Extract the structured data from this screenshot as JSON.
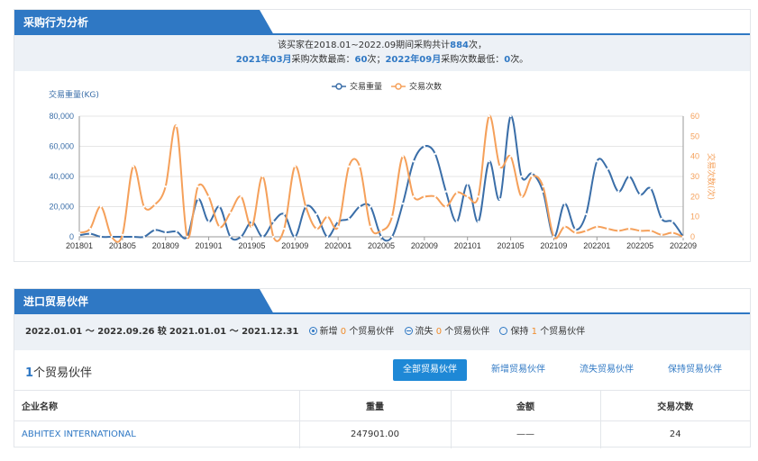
{
  "section1": {
    "title": "采购行为分析",
    "summary": {
      "line1_prefix": "该买家在2018.01~2022.09期间采购共计",
      "total": "884",
      "line1_suffix": "次，",
      "peak_month": "2021年03月",
      "peak_text": "采购次数最高：",
      "peak_value": "60",
      "peak_suffix": "次；",
      "low_month": "2022年09月",
      "low_text": "采购次数最低：",
      "low_value": "0",
      "low_suffix": "次。"
    }
  },
  "chart_data": {
    "type": "line",
    "title": "",
    "ylabel": "交易重量(KG)",
    "y2label": "交易次数(次)",
    "ylim": [
      0,
      80000
    ],
    "y2lim": [
      0,
      60
    ],
    "yticks": [
      "0",
      "20,000",
      "40,000",
      "60,000",
      "80,000"
    ],
    "y2ticks": [
      "0",
      "10",
      "20",
      "30",
      "40",
      "50",
      "60"
    ],
    "xticks": [
      "201801",
      "201805",
      "201809",
      "201901",
      "201905",
      "201909",
      "202001",
      "202005",
      "202009",
      "202101",
      "202105",
      "202109",
      "202201",
      "202205",
      "202209"
    ],
    "legend_position": "top-center",
    "x": [
      "201801",
      "201802",
      "201803",
      "201804",
      "201805",
      "201806",
      "201807",
      "201808",
      "201809",
      "201810",
      "201811",
      "201812",
      "201901",
      "201902",
      "201903",
      "201904",
      "201905",
      "201906",
      "201907",
      "201908",
      "201909",
      "201910",
      "201911",
      "201912",
      "202001",
      "202002",
      "202003",
      "202004",
      "202005",
      "202006",
      "202007",
      "202008",
      "202009",
      "202010",
      "202011",
      "202012",
      "202101",
      "202102",
      "202103",
      "202104",
      "202105",
      "202106",
      "202107",
      "202108",
      "202109",
      "202110",
      "202111",
      "202112",
      "202201",
      "202202",
      "202203",
      "202204",
      "202205",
      "202206",
      "202207",
      "202208",
      "202209"
    ],
    "series": [
      {
        "name": "交易重量",
        "color": "#3a6ea8",
        "axis": "left",
        "values": [
          1000,
          2000,
          0,
          0,
          0,
          0,
          0,
          4500,
          3000,
          3500,
          0,
          25000,
          10000,
          20000,
          0,
          0,
          10000,
          0,
          10000,
          15000,
          0,
          20000,
          15000,
          0,
          10000,
          12000,
          20000,
          20000,
          0,
          0,
          22000,
          50000,
          60000,
          55000,
          30000,
          10000,
          35000,
          10000,
          50000,
          25000,
          80000,
          40000,
          42000,
          30000,
          0,
          22000,
          5000,
          15000,
          50000,
          45000,
          30000,
          40000,
          28000,
          32000,
          12000,
          10000,
          0
        ]
      },
      {
        "name": "交易次数",
        "color": "#f5a05a",
        "axis": "right",
        "values": [
          2,
          4,
          15,
          0,
          1,
          35,
          15,
          16,
          25,
          55,
          0,
          25,
          20,
          5,
          12,
          20,
          5,
          30,
          0,
          4,
          35,
          15,
          4,
          10,
          5,
          35,
          35,
          5,
          3,
          10,
          40,
          20,
          20,
          20,
          15,
          22,
          20,
          20,
          60,
          35,
          40,
          20,
          30,
          25,
          0,
          5,
          2,
          3,
          5,
          4,
          3,
          4,
          3,
          3,
          1,
          2,
          0
        ]
      }
    ]
  },
  "section2": {
    "title": "进口贸易伙伴",
    "filter": {
      "range_a": "2022.01.01 ～ 2022.09.26",
      "compare_word": "较",
      "range_b": "2021.01.01 ～ 2021.12.31",
      "new_label": "新增",
      "new_count": "0",
      "lost_label": "流失",
      "lost_count": "0",
      "keep_label": "保持",
      "keep_count": "1",
      "unit": "个贸易伙伴"
    },
    "partner_count": "1",
    "partner_count_suffix": "个贸易伙伴",
    "buttons": [
      "全部贸易伙伴",
      "新增贸易伙伴",
      "流失贸易伙伴",
      "保持贸易伙伴"
    ],
    "table": {
      "headers": [
        "企业名称",
        "重量",
        "金额",
        "交易次数"
      ],
      "rows": [
        {
          "name": "ABHITEX INTERNATIONAL",
          "weight": "247901.00",
          "amount": "——",
          "count": "24"
        }
      ]
    }
  }
}
